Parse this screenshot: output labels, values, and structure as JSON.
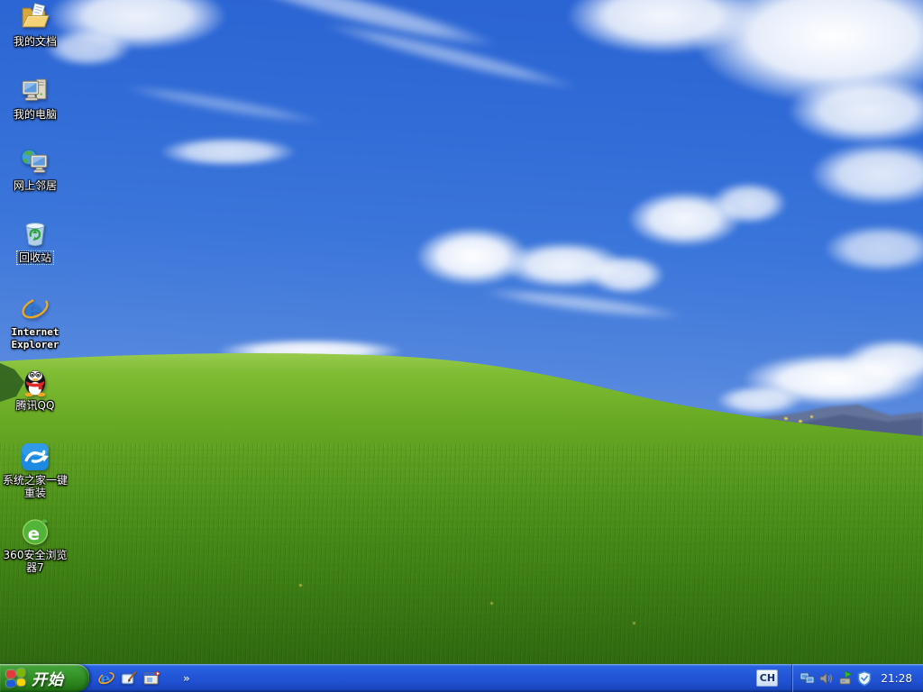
{
  "desktop": {
    "icons": [
      {
        "name": "my-documents",
        "label": "我的文档",
        "icon": "open-folder-document-icon",
        "selected": false
      },
      {
        "name": "my-computer",
        "label": "我的电脑",
        "icon": "computer-monitor-tower-icon",
        "selected": false
      },
      {
        "name": "network-places",
        "label": "网上邻居",
        "icon": "globe-monitor-icon",
        "selected": false
      },
      {
        "name": "recycle-bin",
        "label": "回收站",
        "icon": "recycle-bin-icon",
        "selected": true
      },
      {
        "name": "internet-explorer",
        "label": "Internet Explorer",
        "icon": "ie-blue-e-icon",
        "selected": false
      },
      {
        "name": "tencent-qq",
        "label": "腾讯QQ",
        "icon": "qq-penguin-icon",
        "selected": false
      },
      {
        "name": "system-home-reinstall",
        "label": "系统之家一键重装",
        "icon": "blue-swoosh-app-icon",
        "selected": false
      },
      {
        "name": "360-safe-browser",
        "label": "360安全浏览器7",
        "icon": "green-e-browser-icon",
        "selected": false
      }
    ]
  },
  "taskbar": {
    "start_label": "开始",
    "quick_launch": [
      {
        "name": "internet-explorer-quicklaunch",
        "icon": "ie-icon"
      },
      {
        "name": "show-desktop-quicklaunch",
        "icon": "show-desktop-icon"
      },
      {
        "name": "media-player-quicklaunch",
        "icon": "media-player-icon"
      }
    ],
    "overflow_chevron": "»",
    "language_indicator": "CH",
    "tray_icons": [
      "network-icon",
      "volume-icon",
      "safely-remove-hardware-icon",
      "security-shield-icon"
    ],
    "clock": "21:28"
  },
  "colors": {
    "taskbar_blue": "#2459da",
    "start_button_green": "#359328",
    "sky_top_blue": "#2a63d2",
    "grass_green": "#4e921a",
    "selection_dotted": "#e7d9ab"
  }
}
